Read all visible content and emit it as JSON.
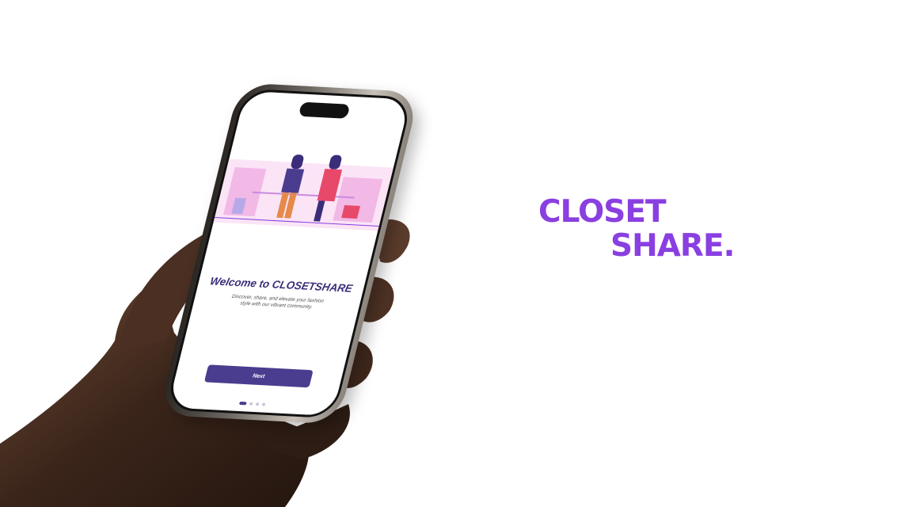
{
  "brand": {
    "line1": "CLOSET",
    "line2": "SHARE."
  },
  "screen": {
    "title": "Welcome to CLOSETSHARE",
    "subtitle_line1": "Discover, share, and elevate your fashion",
    "subtitle_line2": "style with our vibrant community.",
    "next_label": "Next",
    "pager": {
      "count": 4,
      "active": 1
    }
  },
  "colors": {
    "accent": "#8a3fe0",
    "primary": "#4a3d8f",
    "title": "#3b2d7a",
    "illustration_pink": "#f2b8e6"
  },
  "icons": [
    "dynamic-island",
    "onboarding-illustration"
  ]
}
